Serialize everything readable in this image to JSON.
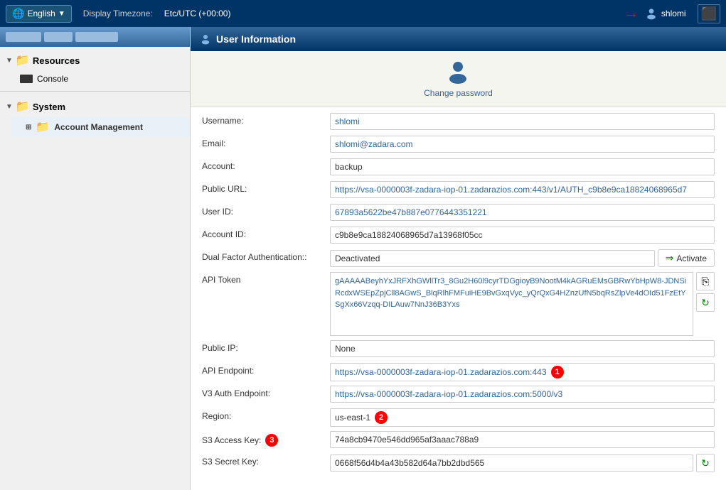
{
  "topbar": {
    "language": "English",
    "timezone_label": "Display Timezone:",
    "timezone_value": "Etc/UTC (+00:00)",
    "username": "shlomi",
    "logout_label": "Logout"
  },
  "sidebar": {
    "resources_label": "Resources",
    "console_label": "Console",
    "system_label": "System",
    "account_management_label": "Account Management"
  },
  "content_header": "User Information",
  "change_password": "Change password",
  "fields": {
    "username_label": "Username:",
    "username_value": "shlomi",
    "email_label": "Email:",
    "email_value": "shlomi@zadara.com",
    "account_label": "Account:",
    "account_value": "backup",
    "public_url_label": "Public URL:",
    "public_url_value": "https://vsa-0000003f-zadara-iop-01.zadarazios.com:443/v1/AUTH_c9b8e9ca18824068965d7",
    "user_id_label": "User ID:",
    "user_id_value": "67893a5622be47b887e0776443351221",
    "account_id_label": "Account ID:",
    "account_id_value": "c9b8e9ca18824068965d7a13968f05cc",
    "dual_factor_label": "Dual Factor Authentication::",
    "dual_factor_value": "Deactivated",
    "activate_label": "Activate",
    "api_token_label": "API Token",
    "api_token_value": "gAAAAABeyhYxJRFXhGWllTr3_8Gu2H60l9cyrTDGgioyB9NootM4kAGRuEMsGBRwYbHpW8-JDNSiRcdxWSEpZpjCll8AGwS_BlqRlhFMFuiHE9BvGxqVyc_yQrQxG4HZnzUfN5bqRsZlpVe4dOId51FzEtYSgXx66Vzqq-DILAuw7NnJ36B3Yxs",
    "public_ip_label": "Public IP:",
    "public_ip_value": "None",
    "api_endpoint_label": "API Endpoint:",
    "api_endpoint_value": "https://vsa-0000003f-zadara-iop-01.zadarazios.com:443",
    "v3_auth_label": "V3 Auth Endpoint:",
    "v3_auth_value": "https://vsa-0000003f-zadara-iop-01.zadarazios.com:5000/v3",
    "region_label": "Region:",
    "region_value": "us-east-1",
    "s3_access_label": "S3 Access Key:",
    "s3_access_value": "74a8cb9470e546dd965af3aaac788a9",
    "s3_secret_label": "S3 Secret Key:",
    "s3_secret_value": "0668f56d4b4a43b582d64a7bb2dbd565"
  },
  "badges": {
    "api_endpoint_badge": "1",
    "region_badge": "2",
    "s3_access_badge": "3"
  }
}
